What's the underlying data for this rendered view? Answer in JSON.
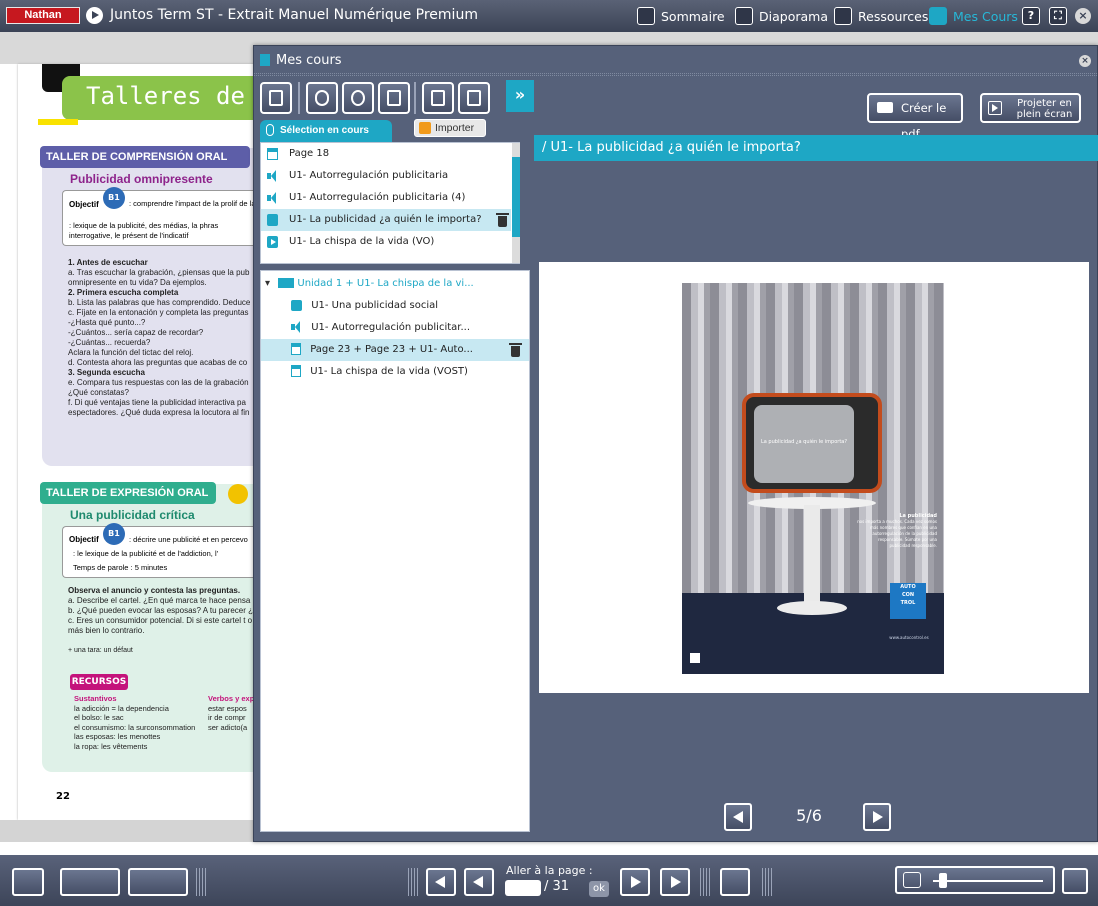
{
  "topbar": {
    "logo": "Nathan",
    "app_title": "Juntos Term ST - Extrait Manuel Numérique Premium",
    "nav": [
      "Sommaire",
      "Diaporama",
      "Ressources",
      "Mes Cours"
    ],
    "help": "?"
  },
  "book": {
    "title": "Talleres de co",
    "sections": [
      {
        "header": "TALLER DE COMPRENSIÓN ORAL",
        "subtitle": "Publicidad omnipresente",
        "objectif_label": "Objectif",
        "level": "B1",
        "objectif_text": ": comprendre l'impact de la prolif de la publicité.",
        "tool_text": ": lexique de la publicité, des médias, la phras interrogative, le présent de l'indicatif",
        "steps": [
          "1. Antes de escuchar",
          "a. Tras escuchar la grabación, ¿piensas que la pub omnipresente en tu vida? Da ejemplos.",
          "2. Primera escucha completa",
          "b. Lista las palabras que has comprendido. Deduce",
          "c. Fíjate en la entonación y completa las preguntas",
          "-¿Hasta qué punto...?",
          "-¿Cuántos... sería capaz de recordar?",
          "-¿Cuántas... recuerda?",
          "Aclara la función del tictac del reloj.",
          "d. Contesta ahora las preguntas que acabas de co",
          "3. Segunda escucha",
          "e. Compara tus respuestas con las de la grabación ¿Qué constatas?",
          "f. Di qué ventajas tiene la publicidad interactiva pa espectadores. ¿Qué duda expresa la locutora al fin"
        ]
      },
      {
        "header": "TALLER DE EXPRESIÓN ORAL",
        "subtitle": "Una publicidad crítica",
        "objectif_label": "Objectif",
        "level": "B1",
        "objectif_text": ": décrire une publicité et en percevo",
        "tool_text": ": le lexique de la publicité et de l'addiction, l'",
        "time_text": "Temps de parole : 5 minutes",
        "steps": [
          "Observa el anuncio y contesta las preguntas.",
          "a. Describe el cartel. ¿En qué marca te hace pensa",
          "b. ¿Qué pueden evocar las esposas? A tu parecer ¿q",
          "c. Eres un consumidor potencial. Di si este cartel t o más bien lo contrario.",
          "+ una tara: un défaut"
        ],
        "recursos_label": "RECURSOS",
        "col1_title": "Sustantivos",
        "col1": [
          "la adicción = la dependencia",
          "el bolso: le sac",
          "el consumismo: la surconsommation",
          "las esposas: les menottes",
          "la ropa: les vêtements"
        ],
        "col2_title": "Verbos y expr",
        "col2": [
          "estar espos",
          "ir de compr",
          "ser adicto(a"
        ]
      }
    ],
    "page_number": "22"
  },
  "panel": {
    "title": "Mes cours",
    "expand_glyph": "»",
    "tab_selection": "Sélection en cours",
    "import_label": "Importer",
    "selection_items": [
      {
        "icon": "page-icon",
        "label": "Page 18"
      },
      {
        "icon": "audio-icon",
        "label": "U1- Autorregulación publicitaria"
      },
      {
        "icon": "audio-icon",
        "label": "U1- Autorregulación publicitaria (4)"
      },
      {
        "icon": "image-icon",
        "label": "U1- La publicidad ¿a quién le importa?"
      },
      {
        "icon": "video-icon",
        "label": "U1- La chispa de la vida (VO)"
      }
    ],
    "tree": {
      "root_label": "Unidad 1 + U1- La chispa de la vi...",
      "children": [
        {
          "icon": "image-icon",
          "label": "U1- Una publicidad social"
        },
        {
          "icon": "audio-icon",
          "label": "U1- Autorregulación publicitar..."
        },
        {
          "icon": "page-icon",
          "label": "Page 23 + Page 23 + U1- Auto..."
        },
        {
          "icon": "page-icon",
          "label": "U1- La chispa de la vida (VOST)"
        }
      ]
    },
    "create_pdf": "Créer le pdf",
    "project_line1": "Projeter en",
    "project_line2": "plein écran",
    "breadcrumb": "/ U1- La publicidad ¿a quién le importa?",
    "poster": {
      "screen_text": "La publicidad ¿a quién le importa?",
      "blurb_title": "La publicidad",
      "blurb": "nos importa a muchos. Cada vez somos más nombres que confían en una autorregulación de la publicidad responsable. Súmate por una publicidad responsable.",
      "brand": [
        "AUTO",
        "CON",
        "TROL"
      ],
      "url": "www.autocontrol.es"
    },
    "pager": "5/6"
  },
  "bottombar": {
    "goto_label": "Aller à la page :",
    "goto_value": "",
    "goto_total": "/ 31",
    "ok": "ok"
  }
}
